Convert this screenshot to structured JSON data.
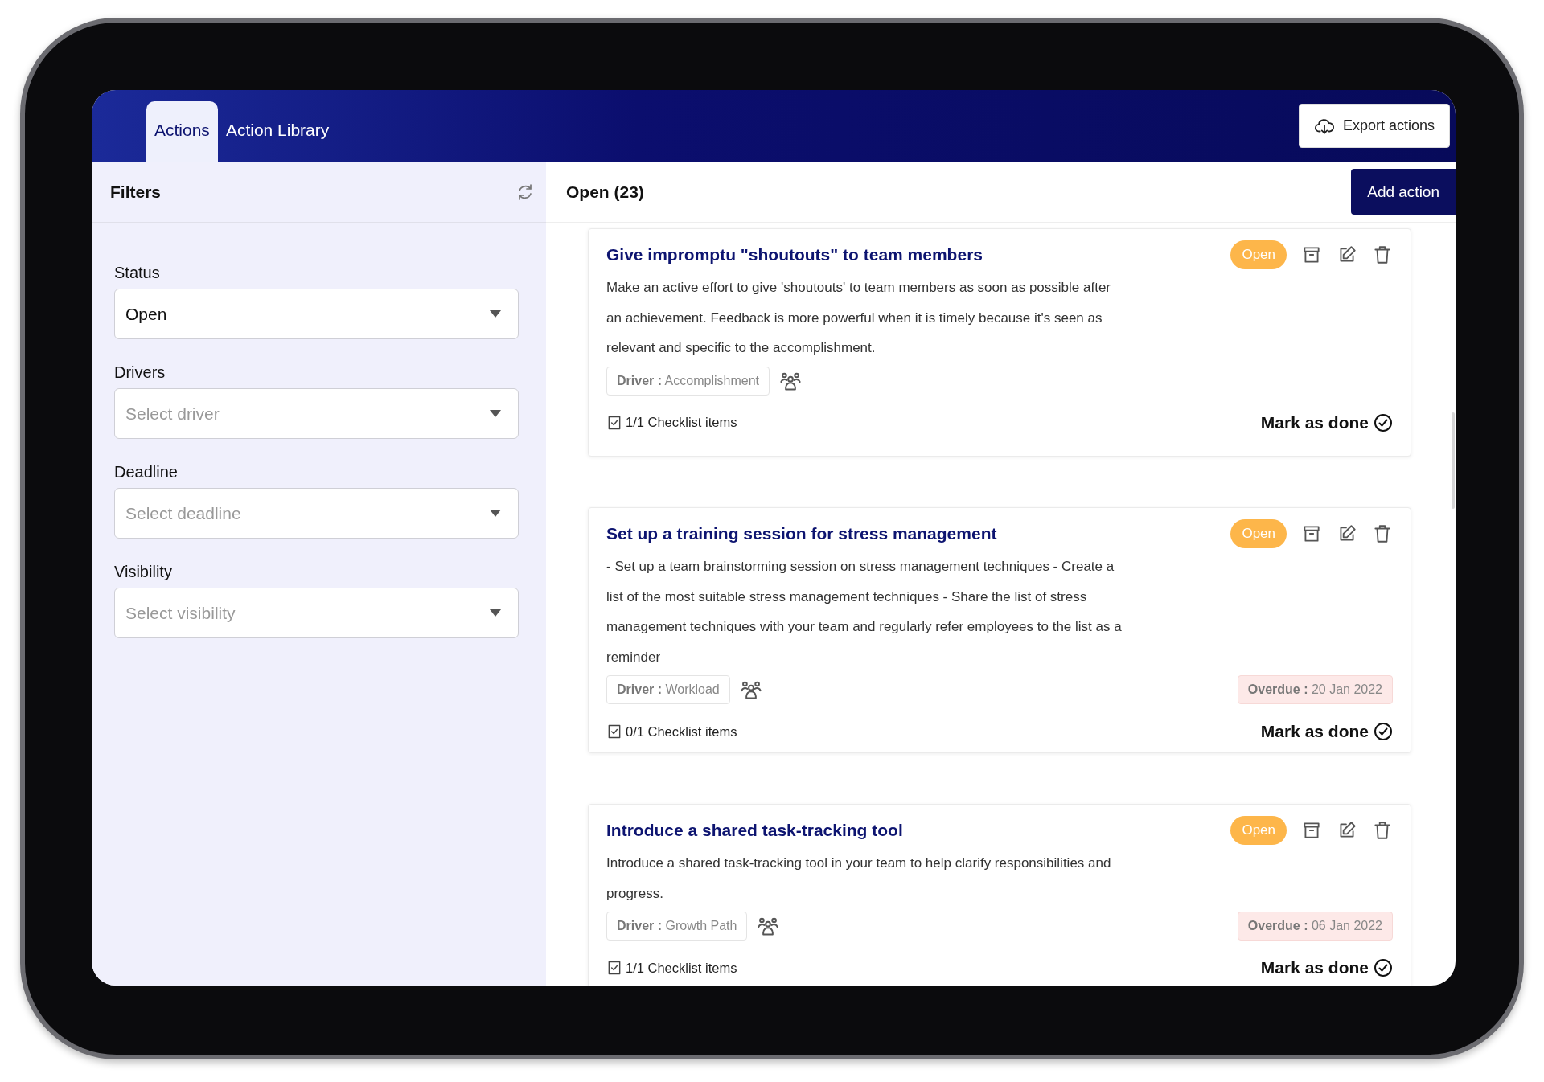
{
  "tabs": [
    {
      "label": "Actions",
      "selected": true
    },
    {
      "label": "Action Library",
      "selected": false
    }
  ],
  "export_button": {
    "label": "Export actions"
  },
  "filters": {
    "title": "Filters",
    "fields": [
      {
        "label": "Status",
        "value": "Open"
      },
      {
        "label": "Drivers",
        "placeholder": "Select driver"
      },
      {
        "label": "Deadline",
        "placeholder": "Select deadline"
      },
      {
        "label": "Visibility",
        "placeholder": "Select visibility"
      }
    ]
  },
  "list": {
    "title": "Open (23)",
    "add_button": "Add action"
  },
  "actions": [
    {
      "title": "Give impromptu \"shoutouts\" to team members",
      "description": "Make an active effort to give 'shoutouts' to team members as soon as possible after an achievement. Feedback is more powerful when it is timely because it's seen as relevant and specific to the accomplishment.",
      "status": "Open",
      "driver_label": "Driver :",
      "driver": "Accomplishment",
      "checklist": "1/1 Checklist items",
      "mark_done": "Mark as done"
    },
    {
      "title": "Set up a training session for stress management",
      "description": "- Set up a team brainstorming session on stress management techniques - Create a list of the most suitable stress management techniques - Share the list of stress management techniques with your team and regularly refer employees to the list as a reminder",
      "status": "Open",
      "driver_label": "Driver :",
      "driver": "Workload",
      "overdue_label": "Overdue :",
      "overdue": "20 Jan 2022",
      "checklist": "0/1 Checklist items",
      "mark_done": "Mark as done"
    },
    {
      "title": "Introduce a shared task-tracking tool",
      "description": "Introduce a shared task-tracking tool in your team to help clarify responsibilities and progress.",
      "status": "Open",
      "driver_label": "Driver :",
      "driver": "Growth Path",
      "overdue_label": "Overdue :",
      "overdue": "06 Jan 2022",
      "checklist": "1/1 Checklist items",
      "mark_done": "Mark as done"
    }
  ]
}
